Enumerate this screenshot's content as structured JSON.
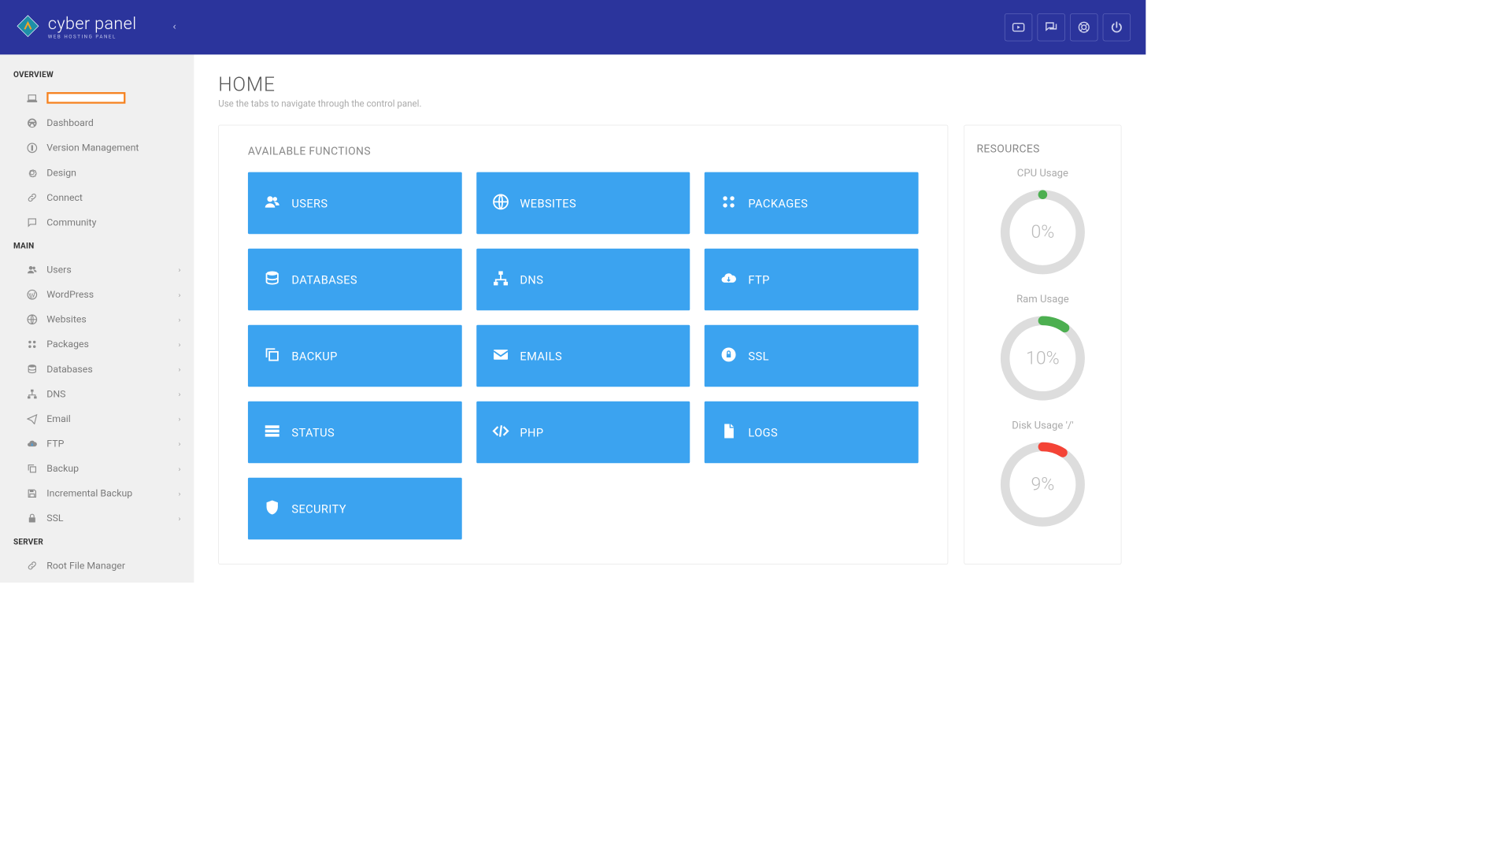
{
  "brand": {
    "name": "cyber panel",
    "tagline": "WEB HOSTING PANEL"
  },
  "sidebar": {
    "sections": [
      {
        "title": "OVERVIEW",
        "items": [
          {
            "label": "",
            "icon": "laptop",
            "highlighted": true
          },
          {
            "label": "Dashboard",
            "icon": "dashboard"
          },
          {
            "label": "Version Management",
            "icon": "info"
          },
          {
            "label": "Design",
            "icon": "gear"
          },
          {
            "label": "Connect",
            "icon": "link"
          },
          {
            "label": "Community",
            "icon": "chat"
          }
        ]
      },
      {
        "title": "MAIN",
        "items": [
          {
            "label": "Users",
            "icon": "users",
            "expandable": true
          },
          {
            "label": "WordPress",
            "icon": "wordpress",
            "expandable": true
          },
          {
            "label": "Websites",
            "icon": "globe",
            "expandable": true
          },
          {
            "label": "Packages",
            "icon": "packages",
            "expandable": true
          },
          {
            "label": "Databases",
            "icon": "database",
            "expandable": true
          },
          {
            "label": "DNS",
            "icon": "sitemap",
            "expandable": true
          },
          {
            "label": "Email",
            "icon": "send",
            "expandable": true
          },
          {
            "label": "FTP",
            "icon": "cloud",
            "expandable": true
          },
          {
            "label": "Backup",
            "icon": "copy",
            "expandable": true
          },
          {
            "label": "Incremental Backup",
            "icon": "save",
            "expandable": true
          },
          {
            "label": "SSL",
            "icon": "lock",
            "expandable": true
          }
        ]
      },
      {
        "title": "SERVER",
        "items": [
          {
            "label": "Root File Manager",
            "icon": "link"
          }
        ]
      }
    ]
  },
  "page": {
    "title": "HOME",
    "subtitle": "Use the tabs to navigate through the control panel."
  },
  "functions": {
    "title": "AVAILABLE FUNCTIONS",
    "tiles": [
      {
        "label": "USERS",
        "icon": "users"
      },
      {
        "label": "WEBSITES",
        "icon": "globe"
      },
      {
        "label": "PACKAGES",
        "icon": "packages"
      },
      {
        "label": "DATABASES",
        "icon": "database"
      },
      {
        "label": "DNS",
        "icon": "sitemap"
      },
      {
        "label": "FTP",
        "icon": "cloud"
      },
      {
        "label": "BACKUP",
        "icon": "copy"
      },
      {
        "label": "EMAILS",
        "icon": "email"
      },
      {
        "label": "SSL",
        "icon": "ssl"
      },
      {
        "label": "STATUS",
        "icon": "status"
      },
      {
        "label": "PHP",
        "icon": "code"
      },
      {
        "label": "LOGS",
        "icon": "file"
      },
      {
        "label": "SECURITY",
        "icon": "shield"
      }
    ]
  },
  "resources": {
    "title": "RESOURCES",
    "gauges": [
      {
        "label": "CPU Usage",
        "value": 0,
        "display": "0%",
        "color": "#4caf50"
      },
      {
        "label": "Ram Usage",
        "value": 10,
        "display": "10%",
        "color": "#4caf50"
      },
      {
        "label": "Disk Usage '/'",
        "value": 9,
        "display": "9%",
        "color": "#f44336"
      }
    ]
  },
  "colors": {
    "tile": "#3ba3f0",
    "header": "#2b349c",
    "highlight": "#f58220"
  }
}
